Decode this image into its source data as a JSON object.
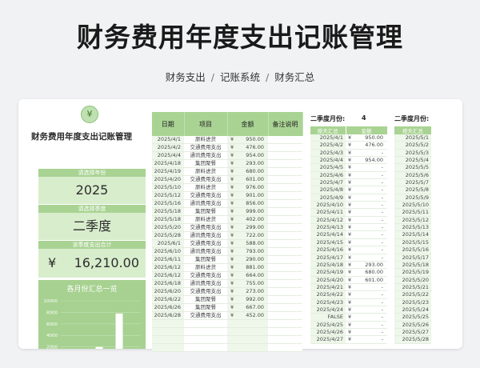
{
  "page": {
    "title": "财务费用年度支出记账管理",
    "subtitle": [
      "财务支出",
      "记账系统",
      "财务汇总"
    ]
  },
  "sheet": {
    "title": "财务费用年度支出记账管理",
    "year_label": "请选择年份",
    "year_value": "2025",
    "quarter_label": "请选择季度",
    "quarter_value": "二季度",
    "total_label": "该季度支出合计",
    "total_currency": "¥",
    "total_value": "16,210.00",
    "chart_title": "各月份汇总一览"
  },
  "colors": {
    "accent": "#a9d393",
    "light": "#d8edcc",
    "bg": "#f1f2f4"
  },
  "main_table": {
    "headers": [
      "日期",
      "项目",
      "金额",
      "备注说明"
    ],
    "rows": [
      [
        "2025/4/1",
        "原料进货",
        "¥",
        "950.00"
      ],
      [
        "2025/4/2",
        "交通费用支出",
        "¥",
        "476.00"
      ],
      [
        "2025/4/4",
        "通讯费用支出",
        "¥",
        "954.00"
      ],
      [
        "2025/4/18",
        "集团聚餐",
        "¥",
        "293.00"
      ],
      [
        "2025/4/19",
        "原料进货",
        "¥",
        "680.00"
      ],
      [
        "2025/4/20",
        "交通费用支出",
        "¥",
        "601.00"
      ],
      [
        "2025/5/10",
        "原料进货",
        "¥",
        "976.00"
      ],
      [
        "2025/5/12",
        "交通费用支出",
        "¥",
        "901.00"
      ],
      [
        "2025/5/16",
        "通讯费用支出",
        "¥",
        "856.00"
      ],
      [
        "2025/5/18",
        "集团聚餐",
        "¥",
        "999.00"
      ],
      [
        "2025/5/18",
        "原料进货",
        "¥",
        "402.00"
      ],
      [
        "2025/5/20",
        "交通费用支出",
        "¥",
        "299.00"
      ],
      [
        "2025/5/28",
        "通讯费用支出",
        "¥",
        "722.00"
      ],
      [
        "2025/6/1",
        "交通费用支出",
        "¥",
        "588.00"
      ],
      [
        "2025/6/10",
        "通讯费用支出",
        "¥",
        "793.00"
      ],
      [
        "2025/6/11",
        "集团聚餐",
        "¥",
        "290.00"
      ],
      [
        "2025/6/12",
        "原料进货",
        "¥",
        "881.00"
      ],
      [
        "2025/6/12",
        "交通费用支出",
        "¥",
        "664.00"
      ],
      [
        "2025/6/18",
        "通讯费用支出",
        "¥",
        "755.00"
      ],
      [
        "2025/6/20",
        "交通费用支出",
        "¥",
        "273.00"
      ],
      [
        "2025/6/22",
        "集团聚餐",
        "¥",
        "992.00"
      ],
      [
        "2025/6/26",
        "集团聚餐",
        "¥",
        "667.00"
      ],
      [
        "2025/6/28",
        "交通费用支出",
        "¥",
        "452.00"
      ],
      [
        "",
        "",
        "",
        ""
      ],
      [
        "",
        "",
        "",
        ""
      ],
      [
        "",
        "",
        "",
        ""
      ],
      [
        "",
        "",
        "",
        ""
      ]
    ]
  },
  "q2": {
    "label": "二季度月份:",
    "month_count": "4",
    "headers": [
      "按天汇总",
      "金额"
    ],
    "rows": [
      [
        "2025/4/1",
        "¥",
        "950.00"
      ],
      [
        "2025/4/2",
        "¥",
        "476.00"
      ],
      [
        "2025/4/3",
        "¥",
        "-"
      ],
      [
        "2025/4/4",
        "¥",
        "954.00"
      ],
      [
        "2025/4/5",
        "¥",
        "-"
      ],
      [
        "2025/4/6",
        "¥",
        "-"
      ],
      [
        "2025/4/7",
        "¥",
        "-"
      ],
      [
        "2025/4/8",
        "¥",
        "-"
      ],
      [
        "2025/4/9",
        "¥",
        "-"
      ],
      [
        "2025/4/10",
        "¥",
        "-"
      ],
      [
        "2025/4/11",
        "¥",
        "-"
      ],
      [
        "2025/4/12",
        "¥",
        "-"
      ],
      [
        "2025/4/13",
        "¥",
        "-"
      ],
      [
        "2025/4/14",
        "¥",
        "-"
      ],
      [
        "2025/4/15",
        "¥",
        "-"
      ],
      [
        "2025/4/16",
        "¥",
        "-"
      ],
      [
        "2025/4/17",
        "¥",
        "-"
      ],
      [
        "2025/4/18",
        "¥",
        "293.00"
      ],
      [
        "2025/4/19",
        "¥",
        "680.00"
      ],
      [
        "2025/4/20",
        "¥",
        "601.00"
      ],
      [
        "2025/4/21",
        "¥",
        "-"
      ],
      [
        "2025/4/22",
        "¥",
        "-"
      ],
      [
        "2025/4/23",
        "¥",
        "-"
      ],
      [
        "2025/4/24",
        "¥",
        "-"
      ],
      [
        "FALSE",
        "¥",
        "-"
      ],
      [
        "2025/4/25",
        "¥",
        "-"
      ],
      [
        "2025/4/26",
        "¥",
        "-"
      ],
      [
        "2025/4/27",
        "¥",
        "-"
      ]
    ]
  },
  "q3": {
    "label": "二季度月份:",
    "headers": [
      "按天汇总"
    ],
    "rows": [
      "2025/5/1",
      "2025/5/2",
      "2025/5/3",
      "2025/5/4",
      "2025/5/5",
      "2025/5/6",
      "2025/5/7",
      "2025/5/8",
      "2025/5/9",
      "2025/5/10",
      "2025/5/11",
      "2025/5/12",
      "2025/5/13",
      "2025/5/14",
      "2025/5/15",
      "2025/5/16",
      "2025/5/17",
      "2025/5/18",
      "2025/5/19",
      "2025/5/20",
      "2025/5/21",
      "2025/5/22",
      "2025/5/23",
      "2025/5/24",
      "2025/5/25",
      "2025/5/26",
      "2025/5/27",
      "2025/5/28"
    ]
  },
  "chart_data": {
    "type": "bar",
    "title": "各月份汇总一览",
    "ylim": [
      0,
      10000
    ],
    "yticks": [
      "10000",
      "8000",
      "6000",
      "4000",
      "2000"
    ],
    "values": [
      1200,
      2000,
      7800
    ]
  }
}
